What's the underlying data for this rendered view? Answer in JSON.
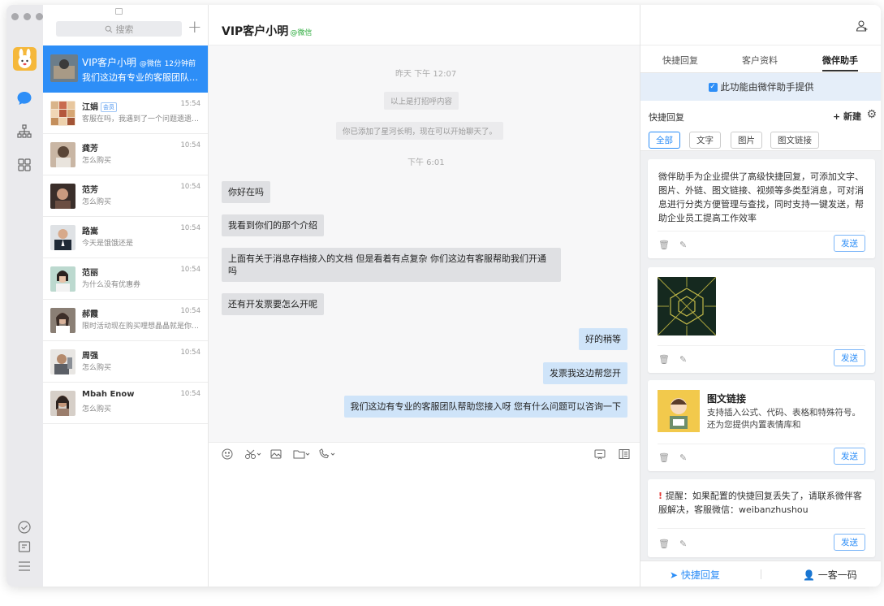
{
  "list": {
    "search_placeholder": "搜索",
    "conversations": [
      {
        "name": "VIP客户小明",
        "source": "@微信",
        "time": "12分钟前",
        "preview": "我们这边有专业的客服团队帮助您接入呀",
        "active": true
      },
      {
        "name": "江娟",
        "tag": "会员",
        "time": "15:54",
        "preview": "客服在吗，我遇到了一个问题遗遗遗遗"
      },
      {
        "name": "龚芳",
        "time": "10:54",
        "preview": "怎么购买"
      },
      {
        "name": "范芳",
        "time": "10:54",
        "preview": "怎么购买"
      },
      {
        "name": "路嵩",
        "time": "10:54",
        "preview": "今天是饿饿还是"
      },
      {
        "name": "范丽",
        "time": "10:54",
        "preview": "为什么没有优惠券"
      },
      {
        "name": "郝霞",
        "time": "10:54",
        "preview": "限时活动现在购买哩想晶晶就是你想想想"
      },
      {
        "name": "周强",
        "time": "10:54",
        "preview": "怎么购买"
      },
      {
        "name": "Mbah Enow",
        "time": "10:54",
        "preview": "怎么购买"
      }
    ]
  },
  "chat": {
    "title": "VIP客户小明",
    "source": "@微信",
    "timestamp1": "昨天 下午 12:07",
    "system1": "以上是打招呼内容",
    "system2": "你已添加了星河长明，现在可以开始聊天了。",
    "timestamp2": "下午 6:01",
    "messages": [
      {
        "dir": "in",
        "text": "你好在吗"
      },
      {
        "dir": "in",
        "text": "我看到你们的那个介绍"
      },
      {
        "dir": "in",
        "text": "上面有关于消息存档接入的文档 但是看着有点复杂 你们这边有客服帮助我们开通吗"
      },
      {
        "dir": "in",
        "text": "还有开发票要怎么开呢"
      },
      {
        "dir": "out",
        "text": "好的稍等"
      },
      {
        "dir": "out",
        "text": "发票我这边帮您开"
      },
      {
        "dir": "out",
        "text": "我们这边有专业的客服团队帮助您接入呀 您有什么问题可以咨询一下"
      }
    ]
  },
  "panel": {
    "tabs": [
      "快捷回复",
      "客户资料",
      "微伴助手"
    ],
    "notice": "此功能由微伴助手提供",
    "quick_reply_label": "快捷回复",
    "new_label": "新建",
    "filters": [
      "全部",
      "文字",
      "图片",
      "图文链接"
    ],
    "cards": [
      {
        "type": "text",
        "text": "微伴助手为企业提供了高级快捷回复，可添加文字、图片、外链、图文链接、视频等多类型消息，可对消息进行分类方便管理与查找，同时支持一键发送，帮助企业员工提高工作效率"
      },
      {
        "type": "image"
      },
      {
        "type": "link",
        "title": "图文链接",
        "desc": "支持插入公式、代码、表格和特殊符号。还为您提供内置表情库和"
      },
      {
        "type": "text",
        "text": "提醒：如果配置的快捷回复丢失了，请联系微伴客服解决，客服微信：weibanzhushou"
      }
    ],
    "send_label": "发送",
    "footer": {
      "quick_reply": "快捷回复",
      "qr_code": "一客一码"
    },
    "accent": "#2d8ef7"
  }
}
